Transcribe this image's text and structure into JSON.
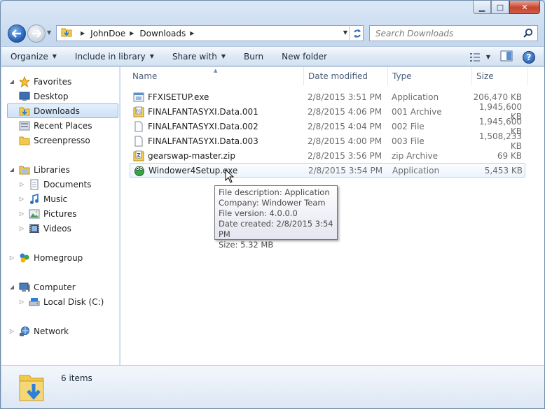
{
  "window": {
    "caption": {
      "minimize": "▁",
      "maximize": "□",
      "close": "✕"
    }
  },
  "address": {
    "crumbs": [
      "JohnDoe",
      "Downloads"
    ]
  },
  "search": {
    "placeholder": "Search Downloads"
  },
  "toolbar": {
    "organize": "Organize",
    "include_in_library": "Include in library",
    "share_with": "Share with",
    "burn": "Burn",
    "new_folder": "New folder"
  },
  "nav": {
    "favorites": "Favorites",
    "desktop": "Desktop",
    "downloads": "Downloads",
    "recent_places": "Recent Places",
    "screenpresso": "Screenpresso",
    "libraries": "Libraries",
    "documents": "Documents",
    "music": "Music",
    "pictures": "Pictures",
    "videos": "Videos",
    "homegroup": "Homegroup",
    "computer": "Computer",
    "local_disk": "Local Disk (C:)",
    "network": "Network"
  },
  "columns": {
    "name": "Name",
    "date_modified": "Date modified",
    "type": "Type",
    "size": "Size"
  },
  "files": [
    {
      "name": "FFXISETUP.exe",
      "date": "2/8/2015 3:51 PM",
      "type": "Application",
      "size": "206,470 KB",
      "icon": "setup-exe-icon"
    },
    {
      "name": "FINALFANTASYXI.Data.001",
      "date": "2/8/2015 4:06 PM",
      "type": "001 Archive",
      "size": "1,945,600 KB",
      "icon": "archive-icon"
    },
    {
      "name": "FINALFANTASYXI.Data.002",
      "date": "2/8/2015 4:04 PM",
      "type": "002 File",
      "size": "1,945,600 KB",
      "icon": "blank-file-icon"
    },
    {
      "name": "FINALFANTASYXI.Data.003",
      "date": "2/8/2015 4:00 PM",
      "type": "003 File",
      "size": "1,508,233 KB",
      "icon": "blank-file-icon"
    },
    {
      "name": "gearswap-master.zip",
      "date": "2/8/2015 3:56 PM",
      "type": "zip Archive",
      "size": "69 KB",
      "icon": "zip-icon"
    },
    {
      "name": "Windower4Setup.exe",
      "date": "2/8/2015 3:54 PM",
      "type": "Application",
      "size": "5,453 KB",
      "icon": "windower-icon"
    }
  ],
  "tooltip": {
    "line1": "File description: Application",
    "line2": "Company: Windower Team",
    "line3": "File version: 4.0.0.0",
    "line4": "Date created: 2/8/2015 3:54 PM",
    "line5": "Size: 5.32 MB"
  },
  "details": {
    "count": "6 items"
  },
  "colors": {
    "selection": "#cde1f7",
    "accent": "#1c5bb4",
    "folder": "#f2c94c"
  }
}
